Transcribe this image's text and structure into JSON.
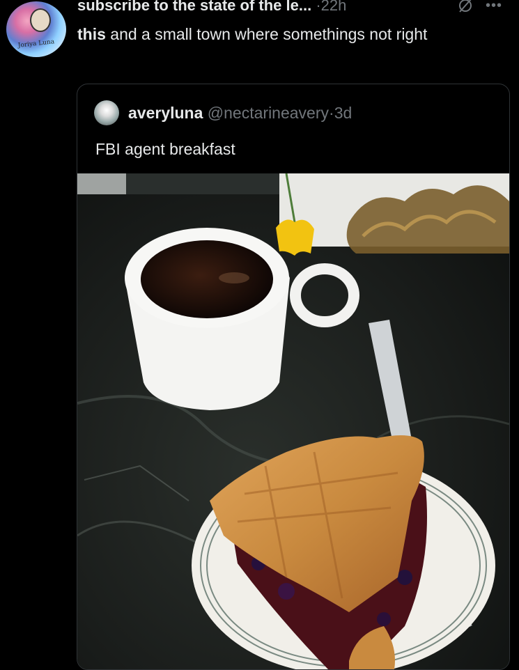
{
  "post": {
    "display_name": "subscribe to the state of the le...",
    "separator": "·",
    "time": "22h",
    "text_bold": "this",
    "text_rest": " and a small town where somethings not right",
    "avatar_text": "Joriya Luna"
  },
  "quote": {
    "display_name": "averyluna",
    "handle": "@nectarineavery",
    "separator": "·",
    "time": "3d",
    "text": "FBI agent breakfast"
  },
  "icons": {
    "grok": "grok-icon",
    "more": "more-icon"
  },
  "colors": {
    "background": "#000000",
    "text": "#e7e9ea",
    "muted": "#71767b",
    "border": "#2f3336"
  }
}
